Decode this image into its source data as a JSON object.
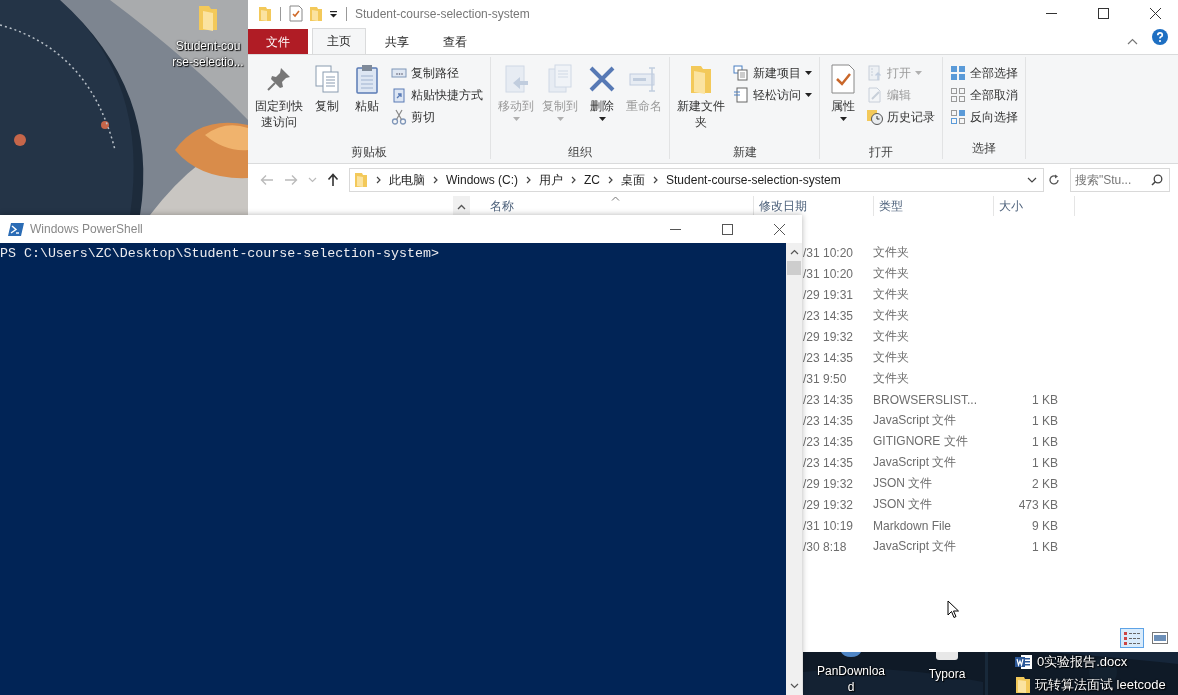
{
  "desktop": {
    "top_icons": [
      {
        "label": "Student-cou\nrse-selectio...",
        "kind": "folder"
      }
    ],
    "bottom_icons": [
      {
        "label": "PanDownloa\nd",
        "kind": "app"
      },
      {
        "label": "Typora",
        "kind": "typora"
      }
    ],
    "files": [
      {
        "label": "0实验报告.docx",
        "kind": "word"
      },
      {
        "label": "玩转算法面试 leetcode",
        "kind": "folder"
      }
    ]
  },
  "explorer": {
    "title": "Student-course-selection-system",
    "tabs": [
      {
        "label": "文件",
        "kind": "file",
        "selected": false
      },
      {
        "label": "主页",
        "kind": "tab",
        "selected": true
      },
      {
        "label": "共享",
        "kind": "tab",
        "selected": false
      },
      {
        "label": "查看",
        "kind": "tab",
        "selected": false
      }
    ],
    "groups": [
      {
        "label": "剪贴板",
        "buttons": [
          {
            "label": "固定到快速访问",
            "kind": "large",
            "disabled": false,
            "dropdown": false
          },
          {
            "label": "复制",
            "kind": "large",
            "disabled": false,
            "dropdown": false
          },
          {
            "label": "粘贴",
            "kind": "large",
            "disabled": false,
            "dropdown": false
          },
          {
            "label": "复制路径",
            "kind": "small",
            "disabled": false,
            "dropdown": false
          },
          {
            "label": "粘贴快捷方式",
            "kind": "small",
            "disabled": false,
            "dropdown": false
          },
          {
            "label": "剪切",
            "kind": "small",
            "disabled": false,
            "dropdown": false
          }
        ]
      },
      {
        "label": "组织",
        "buttons": [
          {
            "label": "移动到",
            "kind": "large",
            "disabled": true,
            "dropdown": true
          },
          {
            "label": "复制到",
            "kind": "large",
            "disabled": true,
            "dropdown": true
          },
          {
            "label": "删除",
            "kind": "large",
            "disabled": false,
            "dropdown": true
          },
          {
            "label": "重命名",
            "kind": "large",
            "disabled": true,
            "dropdown": false
          }
        ]
      },
      {
        "label": "新建",
        "buttons": [
          {
            "label": "新建文件夹",
            "kind": "large",
            "disabled": false,
            "dropdown": false
          },
          {
            "label": "新建项目",
            "kind": "small",
            "disabled": false,
            "dropdown": true
          },
          {
            "label": "轻松访问",
            "kind": "small",
            "disabled": false,
            "dropdown": true
          }
        ]
      },
      {
        "label": "打开",
        "buttons": [
          {
            "label": "属性",
            "kind": "large",
            "disabled": false,
            "dropdown": true
          },
          {
            "label": "打开",
            "kind": "small",
            "disabled": true,
            "dropdown": true
          },
          {
            "label": "编辑",
            "kind": "small",
            "disabled": true,
            "dropdown": false
          },
          {
            "label": "历史记录",
            "kind": "small",
            "disabled": false,
            "dropdown": false
          }
        ]
      },
      {
        "label": "选择",
        "buttons": [
          {
            "label": "全部选择",
            "kind": "small",
            "disabled": false,
            "dropdown": false
          },
          {
            "label": "全部取消",
            "kind": "small",
            "disabled": false,
            "dropdown": false
          },
          {
            "label": "反向选择",
            "kind": "small",
            "disabled": false,
            "dropdown": false
          }
        ]
      }
    ],
    "address": [
      "此电脑",
      "Windows (C:)",
      "用户",
      "ZC",
      "桌面",
      "Student-course-selection-system"
    ],
    "search": {
      "placeholder": "搜索\"Stu..."
    },
    "columns": [
      "名称",
      "修改日期",
      "类型",
      "大小"
    ],
    "rows": [
      {
        "date": "/31 10:20",
        "type": "文件夹"
      },
      {
        "date": "/31 10:20",
        "type": "文件夹"
      },
      {
        "date": "/29 19:31",
        "type": "文件夹"
      },
      {
        "date": "/23 14:35",
        "type": "文件夹"
      },
      {
        "date": "/29 19:32",
        "type": "文件夹"
      },
      {
        "date": "/23 14:35",
        "type": "文件夹"
      },
      {
        "date": "/31 9:50",
        "type": "文件夹"
      },
      {
        "date": "/23 14:35",
        "type": "BROWSERSLIST...",
        "size": "1 KB"
      },
      {
        "date": "/23 14:35",
        "type": "JavaScript 文件",
        "size": "1 KB"
      },
      {
        "date": "/23 14:35",
        "type": "GITIGNORE 文件",
        "size": "1 KB"
      },
      {
        "date": "/23 14:35",
        "type": "JavaScript 文件",
        "size": "1 KB"
      },
      {
        "date": "/29 19:32",
        "type": "JSON 文件",
        "size": "2 KB"
      },
      {
        "date": "/29 19:32",
        "type": "JSON 文件",
        "size": "473 KB"
      },
      {
        "date": "/31 10:19",
        "type": "Markdown File",
        "size": "9 KB"
      },
      {
        "date": "/30 8:18",
        "type": "JavaScript 文件",
        "size": "1 KB"
      }
    ]
  },
  "powershell": {
    "title": "Windows PowerShell",
    "lines": [
      "PS C:\\Users\\ZC\\Desktop\\Student-course-selection-system>"
    ]
  }
}
